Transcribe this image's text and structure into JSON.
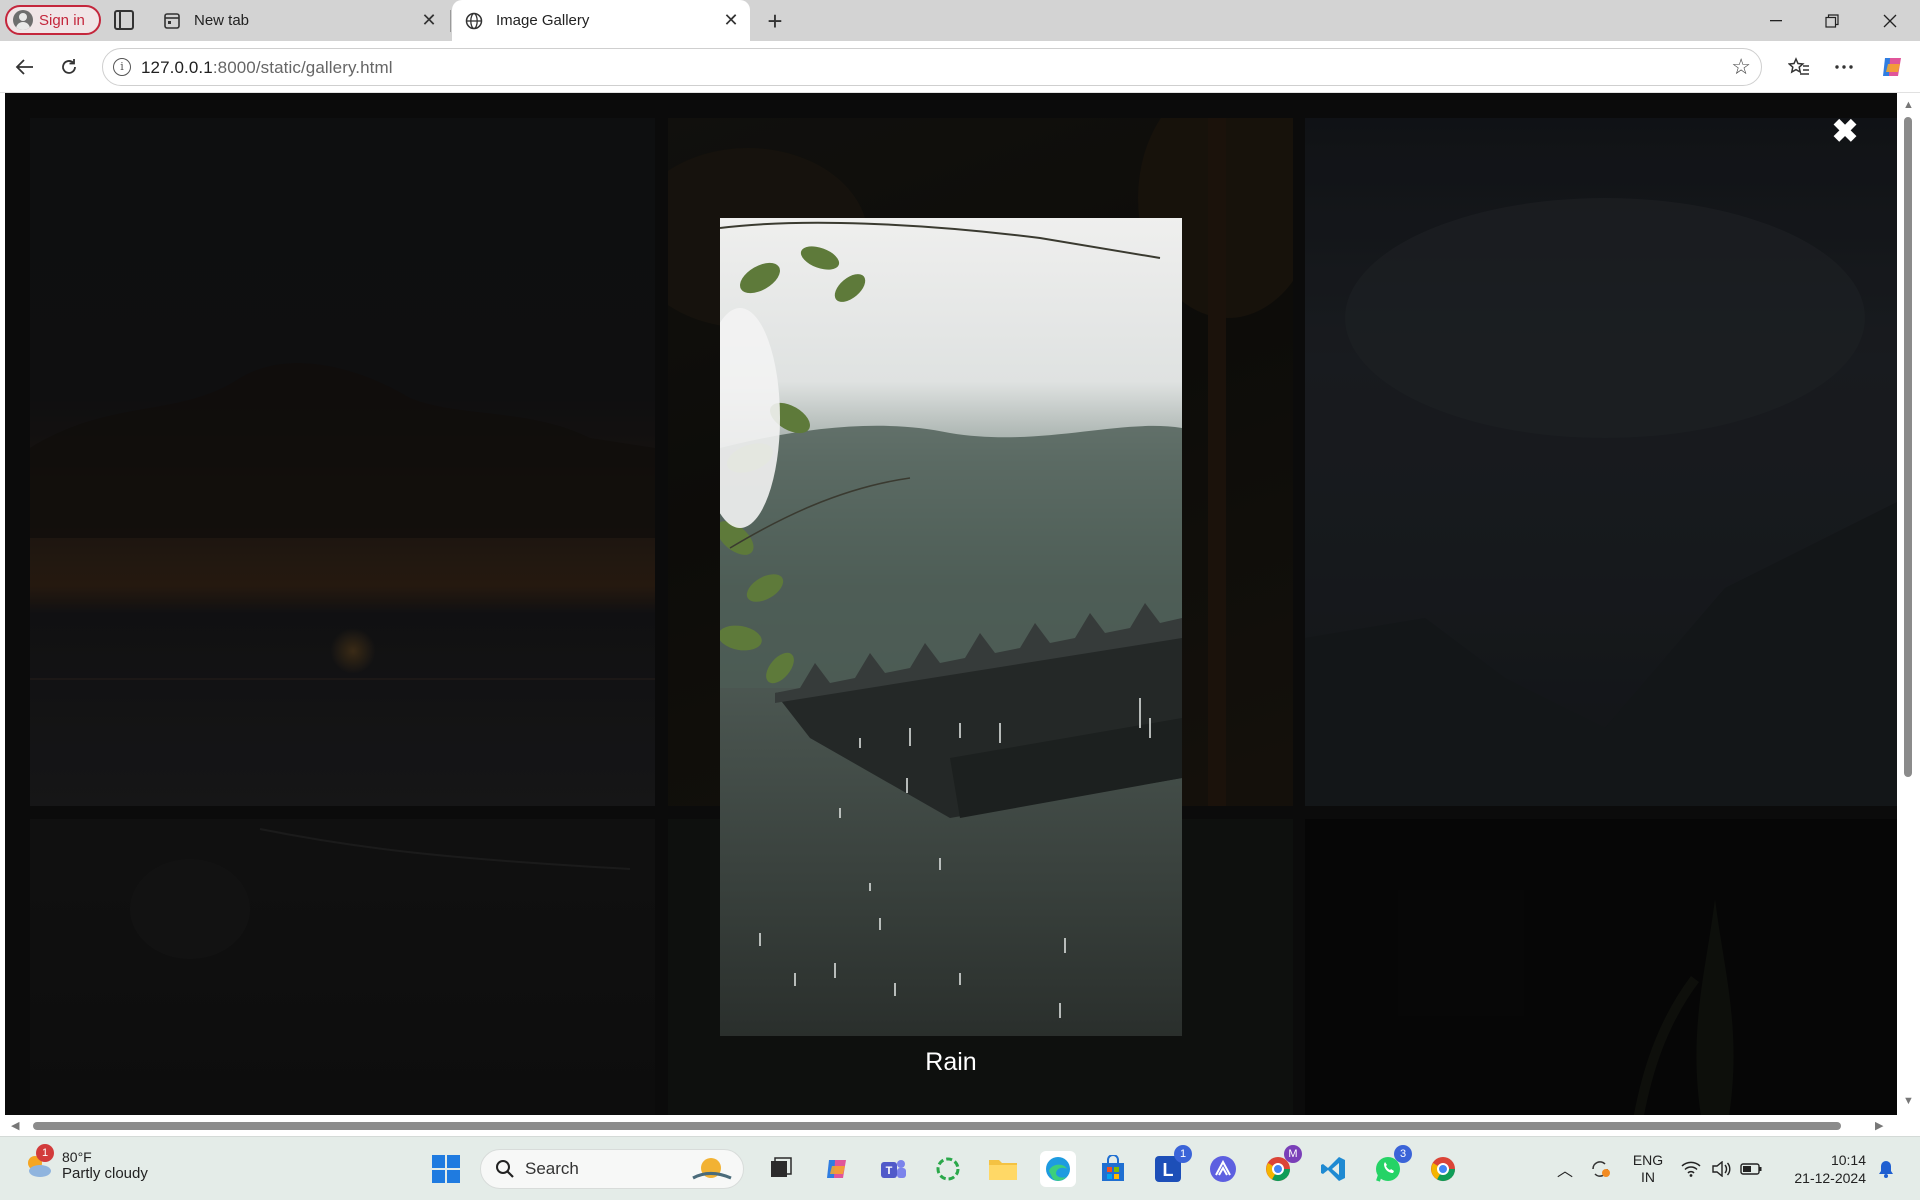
{
  "browser": {
    "profile_button": "Sign in",
    "tabs": [
      {
        "title": "New tab",
        "active": false
      },
      {
        "title": "Image Gallery",
        "active": true
      }
    ],
    "address": {
      "host": "127.0.0.1",
      "path": ":8000/static/gallery.html"
    }
  },
  "lightbox": {
    "caption": "Rain",
    "close_symbol": "✖"
  },
  "taskbar": {
    "weather": {
      "temp": "80°F",
      "desc": "Partly cloudy",
      "badge": "1"
    },
    "search_placeholder": "Search",
    "badges": {
      "linkedin": "1",
      "chrome_profile": "M",
      "whatsapp": "3"
    },
    "language": {
      "line1": "ENG",
      "line2": "IN"
    },
    "clock": {
      "time": "10:14",
      "date": "21-12-2024"
    }
  }
}
